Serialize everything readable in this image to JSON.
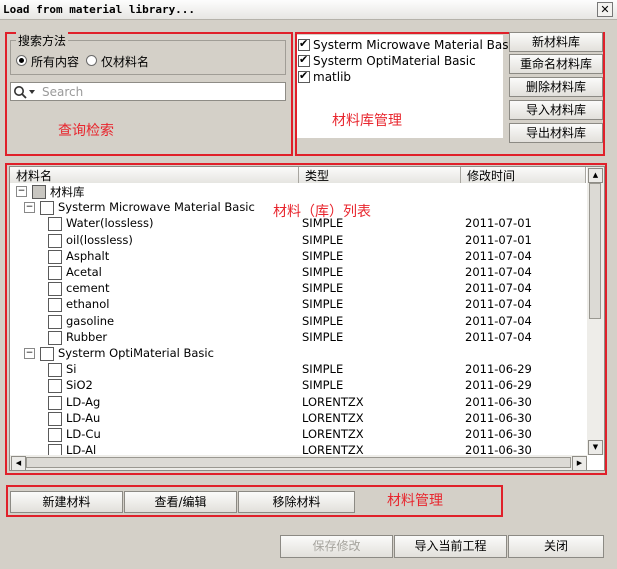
{
  "window": {
    "title": "Load from material library...",
    "close_glyph": "✕"
  },
  "search_panel": {
    "legend": "搜索方法",
    "options": [
      {
        "label": "所有内容",
        "selected": true
      },
      {
        "label": "仅材料名",
        "selected": false
      }
    ],
    "search_placeholder": "Search",
    "annotation": "查询检索"
  },
  "library_panel": {
    "libraries": [
      {
        "name": "Systerm Microwave Material Basic",
        "checked": true
      },
      {
        "name": "Systerm OptiMaterial Basic",
        "checked": true
      },
      {
        "name": "matlib",
        "checked": true
      }
    ],
    "annotation": "材料库管理",
    "buttons": {
      "new": "新材料库",
      "rename": "重命名材料库",
      "delete": "删除材料库",
      "import": "导入材料库",
      "export": "导出材料库"
    }
  },
  "table": {
    "columns": [
      "材料名",
      "类型",
      "修改时间"
    ],
    "annotation": "材料（库）列表",
    "root": "材料库",
    "groups": [
      {
        "name": "Systerm Microwave Material Basic",
        "items": [
          {
            "name": "Water(lossless)",
            "type": "SIMPLE",
            "date": "2011-07-01"
          },
          {
            "name": "oil(lossless)",
            "type": "SIMPLE",
            "date": "2011-07-01"
          },
          {
            "name": "Asphalt",
            "type": "SIMPLE",
            "date": "2011-07-04"
          },
          {
            "name": "Acetal",
            "type": "SIMPLE",
            "date": "2011-07-04"
          },
          {
            "name": "cement",
            "type": "SIMPLE",
            "date": "2011-07-04"
          },
          {
            "name": "ethanol",
            "type": "SIMPLE",
            "date": "2011-07-04"
          },
          {
            "name": "gasoline",
            "type": "SIMPLE",
            "date": "2011-07-04"
          },
          {
            "name": "Rubber",
            "type": "SIMPLE",
            "date": "2011-07-04"
          }
        ]
      },
      {
        "name": "Systerm OptiMaterial Basic",
        "items": [
          {
            "name": "Si",
            "type": "SIMPLE",
            "date": "2011-06-29"
          },
          {
            "name": "SiO2",
            "type": "SIMPLE",
            "date": "2011-06-29"
          },
          {
            "name": "LD-Ag",
            "type": "LORENTZX",
            "date": "2011-06-30"
          },
          {
            "name": "LD-Au",
            "type": "LORENTZX",
            "date": "2011-06-30"
          },
          {
            "name": "LD-Cu",
            "type": "LORENTZX",
            "date": "2011-06-30"
          },
          {
            "name": "LD-Al",
            "type": "LORENTZX",
            "date": "2011-06-30"
          }
        ]
      }
    ]
  },
  "material_actions": {
    "new": "新建材料",
    "view_edit": "查看/编辑",
    "remove": "移除材料",
    "annotation": "材料管理"
  },
  "footer": {
    "save": "保存修改",
    "import_project": "导入当前工程",
    "close": "关闭"
  },
  "colors": {
    "annotation_red": "#e0202a",
    "dialog_bg": "#d4d0c8"
  }
}
